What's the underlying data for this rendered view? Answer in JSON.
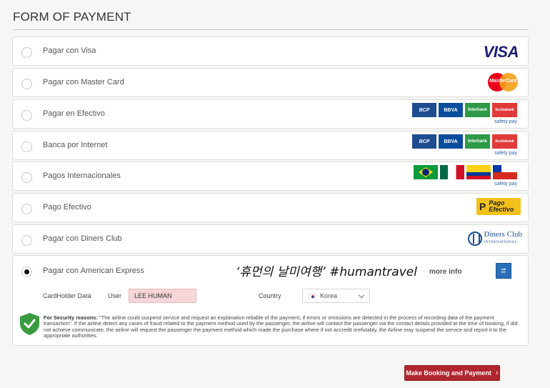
{
  "header": {
    "title": "FORM OF PAYMENT"
  },
  "options": [
    {
      "label": "Pagar con Visa",
      "selected": false,
      "logo": "visa-logo",
      "logo_text": "VISA"
    },
    {
      "label": "Pagar con Master Card",
      "selected": false,
      "logo": "mastercard-logo",
      "logo_text": "MasterCard"
    },
    {
      "label": "Pagar en Efectivo",
      "selected": false,
      "logo": "bank-logos"
    },
    {
      "label": "Banca por Internet",
      "selected": false,
      "logo": "bank-logos"
    },
    {
      "label": "Pagos Internacionales",
      "selected": false,
      "logo": "country-flags"
    },
    {
      "label": "Pago Efectivo",
      "selected": false,
      "logo": "pago-efectivo-logo",
      "logo_text": "Pago Efectivo"
    },
    {
      "label": "Pagar con Diners Club",
      "selected": false,
      "logo": "diners-club-logo",
      "logo_text": "Diners Club",
      "logo_sub": "INTERNATIONAL"
    }
  ],
  "banks": {
    "bcp": "BCP",
    "bbva": "BBVA",
    "interbank": "Interbank",
    "scotia": "Scotiabank",
    "safetypay": "safety pay"
  },
  "amex": {
    "label": "Pagar con American Express",
    "selected": true,
    "more_info": "more info",
    "logo": "amex-logo",
    "watermark": "‘휴먼의 날미여행’ #humantravel",
    "cardholder_label": "CardHolder Data",
    "user_label": "User",
    "user_value": "LEE HUMAN",
    "country_label": "Country",
    "country_value": "Korea",
    "security_heading": "For Security reasons:",
    "security_text": " \"The airline could suspend service and request an explanation reliable of the payment, if errors or omissions are detected in the process of recording data of the payment transaction\". If the airline detect any cases of fraud related to the payment method used by the passenger, the airline will contact the passenger via the contact details provided at the time of booking, if did not achieve communicate, the airline will request the passenger the payment method which made the purchase where if not accredit irrefutably, the Airline may suspend the service and report it to the appropriate authorities."
  },
  "cta": {
    "label": "Make Booking and Payment"
  },
  "colors": {
    "accent": "#b0262e",
    "shield": "#3a9a3e",
    "input_highlight": "#f6d6d8"
  }
}
